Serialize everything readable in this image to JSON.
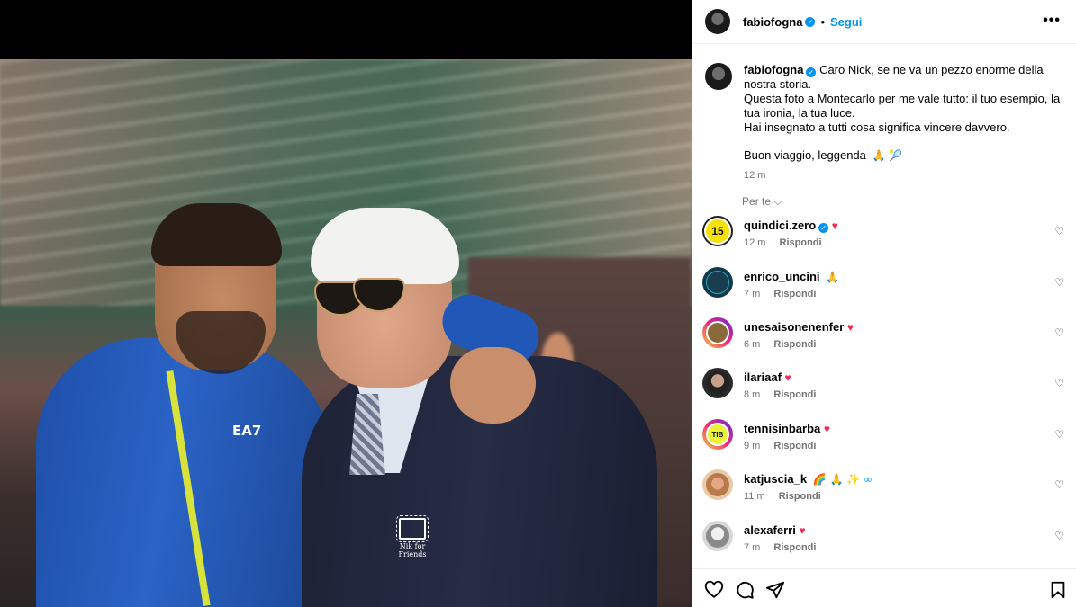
{
  "post": {
    "author": "fabiofogna",
    "dot": "•",
    "follow_label": "Segui",
    "more_label": "•••",
    "image_badge_text": "Nik for Friends",
    "image_logo_text": "EA7"
  },
  "caption": {
    "author": "fabiofogna",
    "line1": "Caro Nick, se ne va un pezzo enorme della nostra storia.",
    "line2": "Questa foto a Montecarlo per me vale tutto: il tuo esempio, la tua ironia, la tua luce.",
    "line3": "Hai insegnato a tutti cosa significa vincere davvero.",
    "line4": "Buon viaggio, leggenda",
    "line4_emoji": "🙏 🎾",
    "time": "12 m"
  },
  "translate_label": "Per te",
  "translate_chevron": "⌵",
  "reply_label": "Rispondi",
  "comments": [
    {
      "user": "quindici.zero",
      "verified": true,
      "text": "♥",
      "time": "12 m",
      "avatar_text": "15"
    },
    {
      "user": "enrico_uncini",
      "verified": false,
      "text": "🙏",
      "time": "7 m",
      "avatar_text": ""
    },
    {
      "user": "unesaisonenenfer",
      "verified": false,
      "text": "♥",
      "time": "6 m",
      "avatar_text": ""
    },
    {
      "user": "ilariaaf",
      "verified": false,
      "text": "♥",
      "time": "8 m",
      "avatar_text": ""
    },
    {
      "user": "tennisinbarba",
      "verified": false,
      "text": "♥",
      "time": "9 m",
      "avatar_text": "TIB"
    },
    {
      "user": "katjuscia_k",
      "verified": false,
      "text": "🌈 🙏 ✨ ∞",
      "time": "11 m",
      "avatar_text": ""
    },
    {
      "user": "alexaferri",
      "verified": false,
      "text": "♥",
      "time": "7 m",
      "avatar_text": ""
    }
  ],
  "icons": {
    "like": "heart-icon",
    "comment": "comment-icon",
    "share": "share-icon",
    "save": "bookmark-icon"
  },
  "colors": {
    "accent": "#0095f6",
    "heart": "#ed2b55",
    "muted": "#737373"
  }
}
